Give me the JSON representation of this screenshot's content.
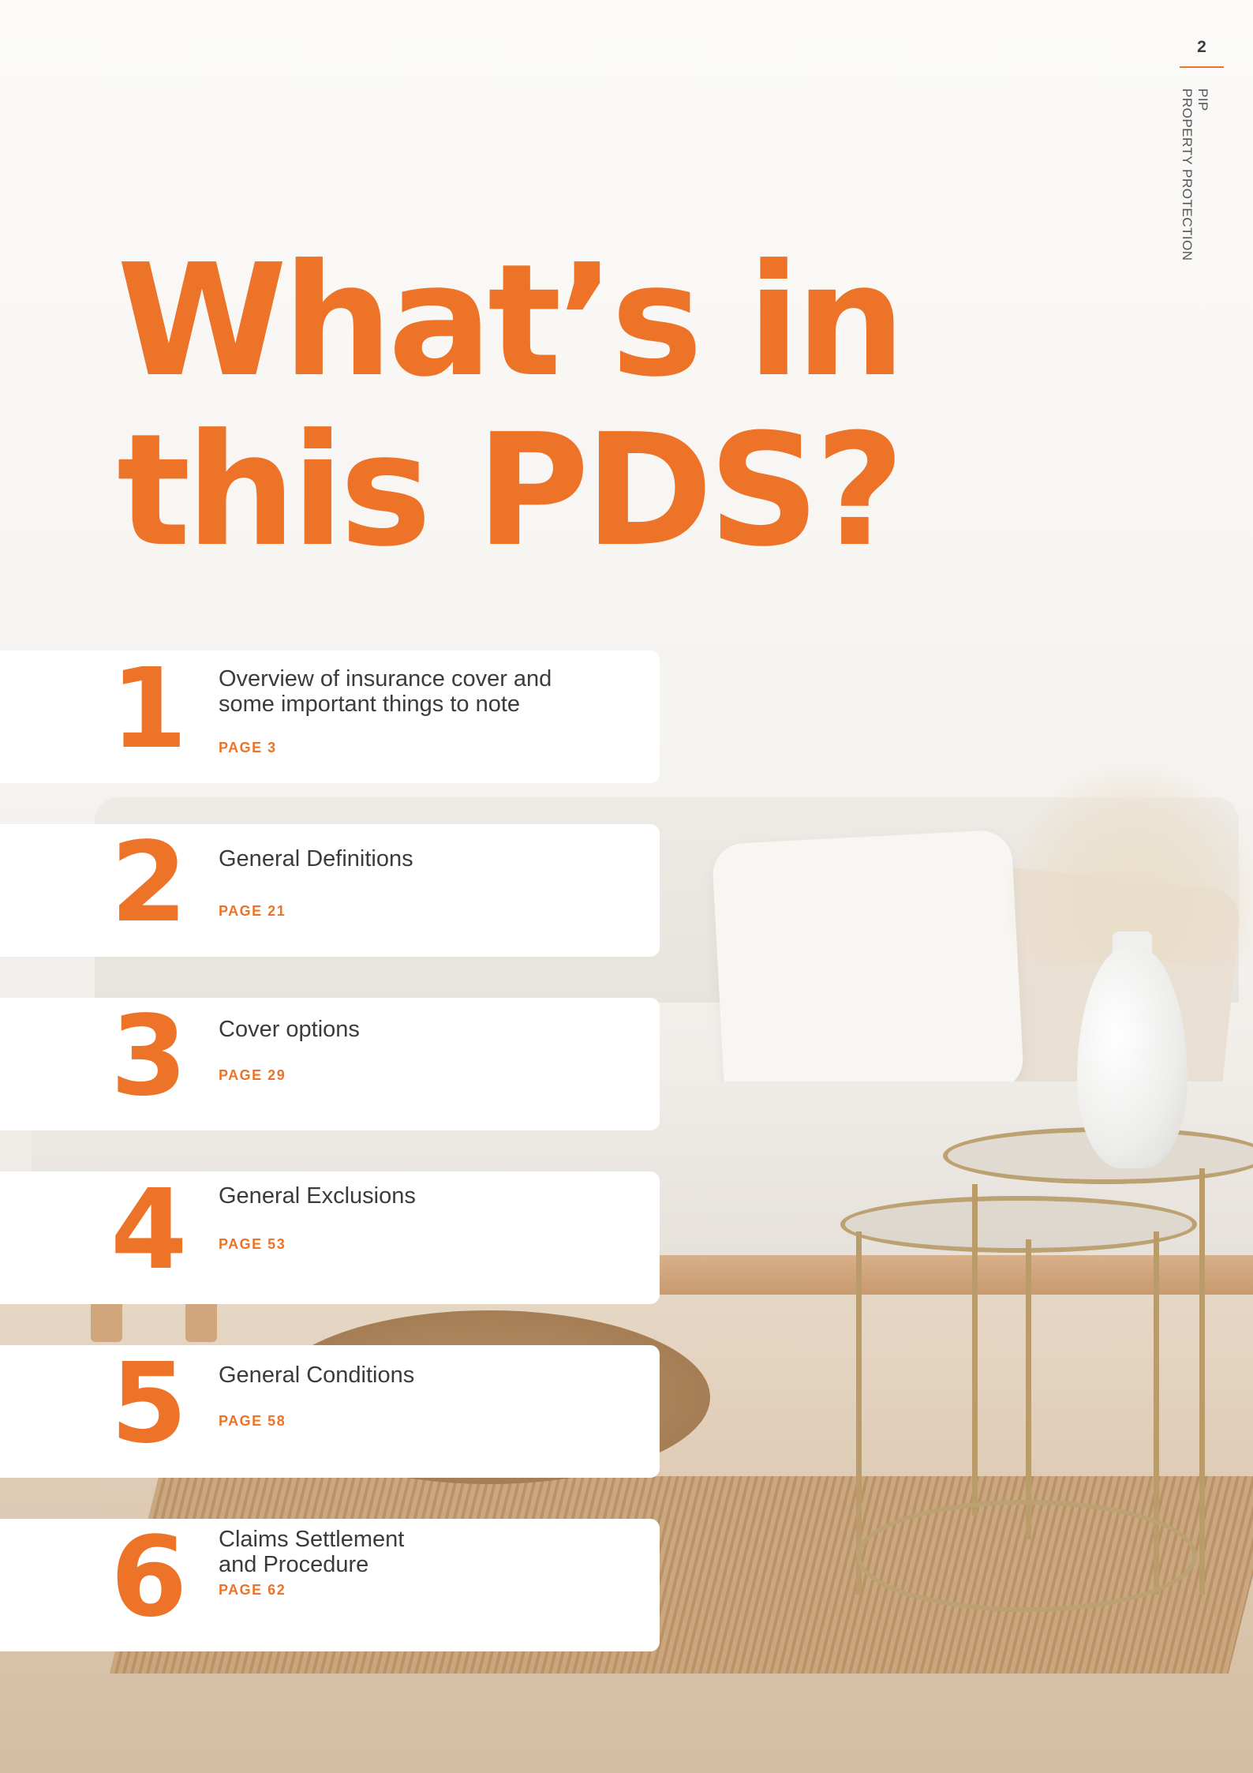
{
  "header": {
    "page_number": "2",
    "side_label_line1": "PIP",
    "side_label_line2": "PROPERTY PROTECTION"
  },
  "title": {
    "line1": "What’s in",
    "line2": "this PDS?"
  },
  "toc": [
    {
      "number": "1",
      "line1": "Overview of insurance cover and",
      "line2": "some important things to note",
      "page": "PAGE 3"
    },
    {
      "number": "2",
      "line1": "General Definitions",
      "line2": "",
      "page": "PAGE 21"
    },
    {
      "number": "3",
      "line1": "Cover options",
      "line2": "",
      "page": "PAGE 29"
    },
    {
      "number": "4",
      "line1": "General Exclusions",
      "line2": "",
      "page": "PAGE 53"
    },
    {
      "number": "5",
      "line1": "General Conditions",
      "line2": "",
      "page": "PAGE 58"
    },
    {
      "number": "6",
      "line1": "Claims Settlement",
      "line2": "and Procedure",
      "page": "PAGE 62"
    }
  ],
  "colors": {
    "accent": "#ec7328",
    "body_text": "#3b3b3b",
    "card": "#ffffff"
  }
}
